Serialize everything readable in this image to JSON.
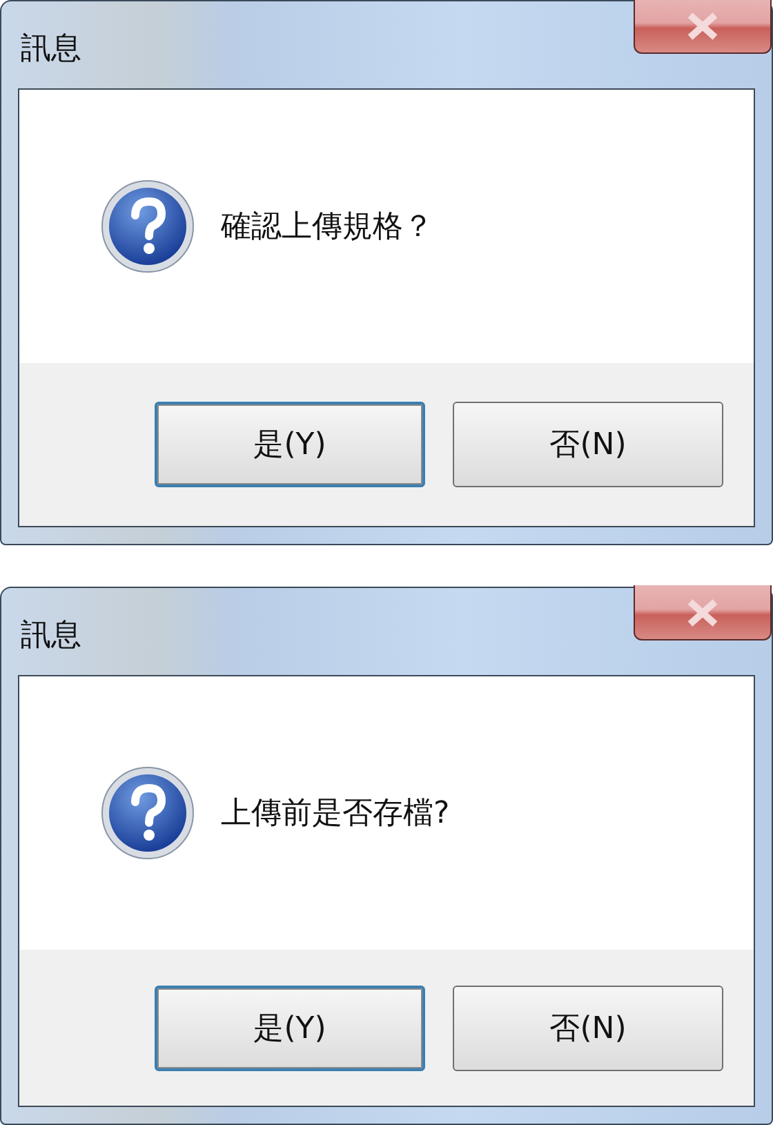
{
  "dialogs": [
    {
      "title": "訊息",
      "message": "確認上傳規格？",
      "buttons": [
        {
          "label": "是(Y)",
          "selected": true
        },
        {
          "label": "否(N)",
          "selected": false
        }
      ]
    },
    {
      "title": "訊息",
      "message": "上傳前是否存檔?",
      "buttons": [
        {
          "label": "是(Y)",
          "selected": true
        },
        {
          "label": "否(N)",
          "selected": false
        }
      ]
    }
  ]
}
